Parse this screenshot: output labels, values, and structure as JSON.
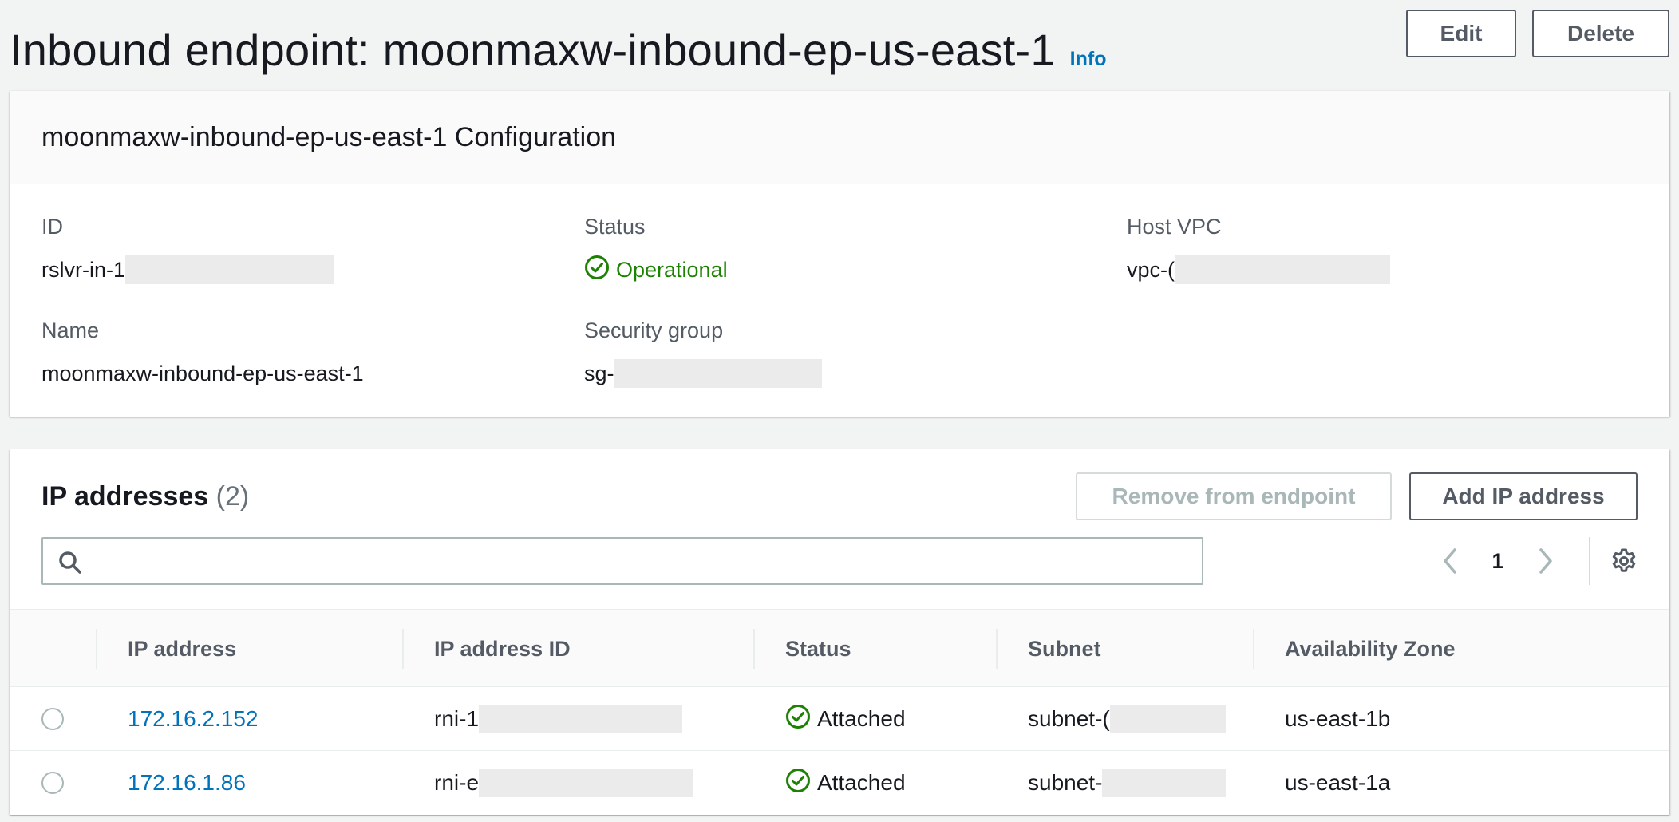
{
  "header": {
    "title": "Inbound endpoint: moonmaxw-inbound-ep-us-east-1",
    "info_label": "Info",
    "edit_label": "Edit",
    "delete_label": "Delete"
  },
  "config": {
    "title": "moonmaxw-inbound-ep-us-east-1 Configuration",
    "id_label": "ID",
    "id_value": "rslvr-in-1",
    "status_label": "Status",
    "status_value": "Operational",
    "host_vpc_label": "Host VPC",
    "host_vpc_value": "vpc-(",
    "name_label": "Name",
    "name_value": "moonmaxw-inbound-ep-us-east-1",
    "security_group_label": "Security group",
    "security_group_value": "sg-"
  },
  "ip_addresses": {
    "title": "IP addresses",
    "count": "(2)",
    "remove_label": "Remove from endpoint",
    "add_label": "Add IP address",
    "search_placeholder": "",
    "page": "1",
    "columns": [
      "IP address",
      "IP address ID",
      "Status",
      "Subnet",
      "Availability Zone"
    ],
    "rows": [
      {
        "ip": "172.16.2.152",
        "ip_id": "rni-1",
        "status": "Attached",
        "subnet": "subnet-(",
        "az": "us-east-1b"
      },
      {
        "ip": "172.16.1.86",
        "ip_id": "rni-e",
        "status": "Attached",
        "subnet": "subnet-",
        "az": "us-east-1a"
      }
    ]
  },
  "colors": {
    "link": "#0073bb",
    "success": "#1d8102",
    "text": "#16191f",
    "label": "#545b64",
    "background": "#f2f3f3"
  },
  "icons": {
    "search": "search-icon",
    "status": "check-circle-icon",
    "prev": "chevron-left-icon",
    "next": "chevron-right-icon",
    "settings": "gear-icon"
  }
}
